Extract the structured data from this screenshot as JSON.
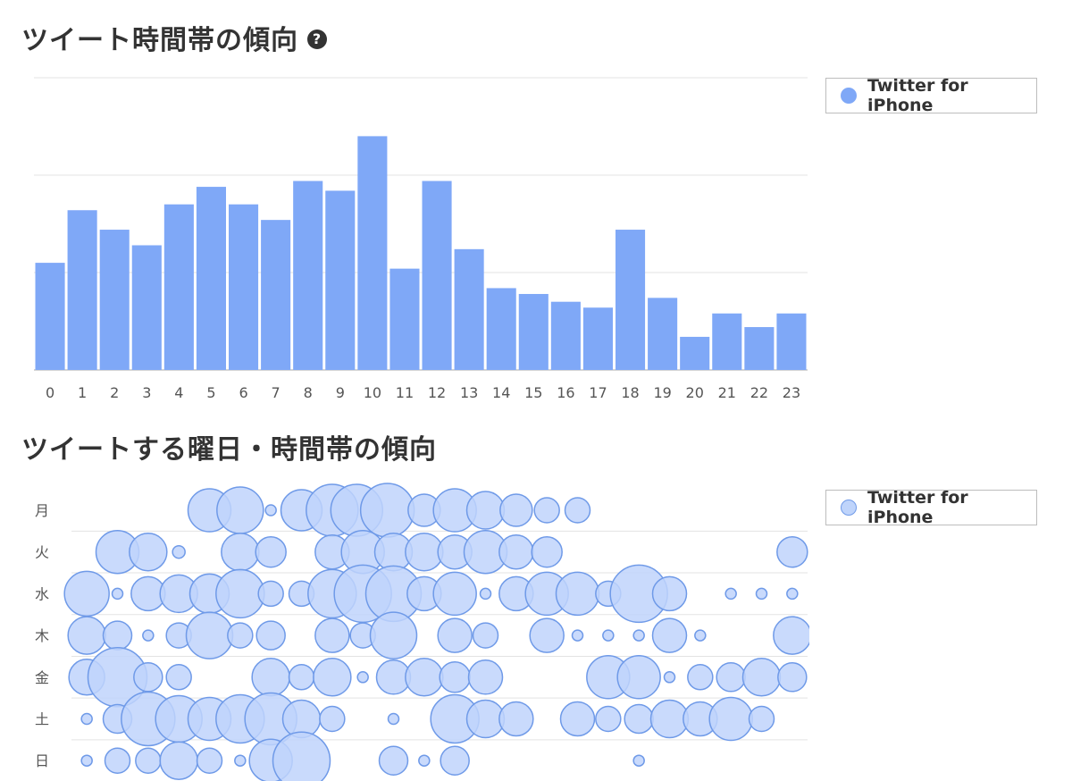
{
  "charts": {
    "hourly": {
      "title": "ツイート時間帯の傾向",
      "help_icon": "question-circle-icon",
      "legend_label": "Twitter for iPhone"
    },
    "weekday_hour": {
      "title": "ツイートする曜日・時間帯の傾向",
      "legend_label": "Twitter for iPhone"
    }
  },
  "colors": {
    "bar": "#7fa8f7",
    "bubble_fill": "#bfd4fb",
    "bubble_stroke": "#6f9ae8",
    "grid": "#e3e3e3",
    "axis": "#d4d4d4"
  },
  "chart_data": [
    {
      "type": "bar",
      "title": "ツイート時間帯の傾向",
      "categories": [
        "0",
        "1",
        "2",
        "3",
        "4",
        "5",
        "6",
        "7",
        "8",
        "9",
        "10",
        "11",
        "12",
        "13",
        "14",
        "15",
        "16",
        "17",
        "18",
        "19",
        "20",
        "21",
        "22",
        "23"
      ],
      "series": [
        {
          "name": "Twitter for iPhone",
          "values": [
            55,
            82,
            72,
            64,
            85,
            94,
            85,
            77,
            97,
            92,
            120,
            52,
            97,
            62,
            42,
            39,
            35,
            32,
            72,
            37,
            17,
            29,
            22,
            29
          ]
        }
      ],
      "ylim": [
        0,
        150
      ],
      "y_gridlines": [
        0,
        50,
        100,
        150
      ],
      "grid": true,
      "legend_position": "top-right"
    },
    {
      "type": "scatter",
      "title": "ツイートする曜日・時間帯の傾向",
      "description": "bubble chart; x = hour of day, y = weekday, bubble radius = count",
      "y_categories": [
        "月",
        "火",
        "水",
        "木",
        "金",
        "土",
        "日"
      ],
      "series": [
        {
          "name": "Twitter for iPhone",
          "points": [
            {
              "day": "月",
              "x": 4.5,
              "r": 24
            },
            {
              "day": "月",
              "x": 5.5,
              "r": 26
            },
            {
              "day": "月",
              "x": 6.5,
              "r": 6
            },
            {
              "day": "月",
              "x": 7.5,
              "r": 23
            },
            {
              "day": "月",
              "x": 8.5,
              "r": 29
            },
            {
              "day": "月",
              "x": 9.3,
              "r": 29
            },
            {
              "day": "月",
              "x": 10.3,
              "r": 30
            },
            {
              "day": "月",
              "x": 11.5,
              "r": 18
            },
            {
              "day": "月",
              "x": 12.5,
              "r": 24
            },
            {
              "day": "月",
              "x": 13.5,
              "r": 21
            },
            {
              "day": "月",
              "x": 14.5,
              "r": 18
            },
            {
              "day": "月",
              "x": 15.5,
              "r": 14
            },
            {
              "day": "月",
              "x": 16.5,
              "r": 14
            },
            {
              "day": "火",
              "x": 1.5,
              "r": 24
            },
            {
              "day": "火",
              "x": 2.5,
              "r": 21
            },
            {
              "day": "火",
              "x": 3.5,
              "r": 7
            },
            {
              "day": "火",
              "x": 5.5,
              "r": 21
            },
            {
              "day": "火",
              "x": 6.5,
              "r": 17
            },
            {
              "day": "火",
              "x": 8.5,
              "r": 19
            },
            {
              "day": "火",
              "x": 9.5,
              "r": 24
            },
            {
              "day": "火",
              "x": 10.5,
              "r": 21
            },
            {
              "day": "火",
              "x": 11.5,
              "r": 21
            },
            {
              "day": "火",
              "x": 12.5,
              "r": 19
            },
            {
              "day": "火",
              "x": 13.5,
              "r": 24
            },
            {
              "day": "火",
              "x": 14.5,
              "r": 19
            },
            {
              "day": "火",
              "x": 15.5,
              "r": 17
            },
            {
              "day": "火",
              "x": 23.5,
              "r": 17
            },
            {
              "day": "水",
              "x": 0.5,
              "r": 25
            },
            {
              "day": "水",
              "x": 1.5,
              "r": 6
            },
            {
              "day": "水",
              "x": 2.5,
              "r": 19
            },
            {
              "day": "水",
              "x": 3.5,
              "r": 21
            },
            {
              "day": "水",
              "x": 4.5,
              "r": 22
            },
            {
              "day": "水",
              "x": 5.5,
              "r": 27
            },
            {
              "day": "水",
              "x": 6.5,
              "r": 14
            },
            {
              "day": "水",
              "x": 7.5,
              "r": 14
            },
            {
              "day": "水",
              "x": 8.5,
              "r": 27
            },
            {
              "day": "水",
              "x": 9.5,
              "r": 32
            },
            {
              "day": "水",
              "x": 10.5,
              "r": 31
            },
            {
              "day": "水",
              "x": 11.5,
              "r": 19
            },
            {
              "day": "水",
              "x": 12.5,
              "r": 24
            },
            {
              "day": "水",
              "x": 13.5,
              "r": 6
            },
            {
              "day": "水",
              "x": 14.5,
              "r": 19
            },
            {
              "day": "水",
              "x": 15.5,
              "r": 24
            },
            {
              "day": "水",
              "x": 16.5,
              "r": 24
            },
            {
              "day": "水",
              "x": 17.5,
              "r": 14
            },
            {
              "day": "水",
              "x": 18.5,
              "r": 32
            },
            {
              "day": "水",
              "x": 19.5,
              "r": 19
            },
            {
              "day": "水",
              "x": 21.5,
              "r": 6
            },
            {
              "day": "水",
              "x": 22.5,
              "r": 6
            },
            {
              "day": "水",
              "x": 23.5,
              "r": 6
            },
            {
              "day": "木",
              "x": 0.5,
              "r": 21
            },
            {
              "day": "木",
              "x": 1.5,
              "r": 16
            },
            {
              "day": "木",
              "x": 2.5,
              "r": 6
            },
            {
              "day": "木",
              "x": 3.5,
              "r": 14
            },
            {
              "day": "木",
              "x": 4.5,
              "r": 26
            },
            {
              "day": "木",
              "x": 5.5,
              "r": 14
            },
            {
              "day": "木",
              "x": 6.5,
              "r": 16
            },
            {
              "day": "木",
              "x": 8.5,
              "r": 19
            },
            {
              "day": "木",
              "x": 9.5,
              "r": 14
            },
            {
              "day": "木",
              "x": 10.5,
              "r": 26
            },
            {
              "day": "木",
              "x": 12.5,
              "r": 19
            },
            {
              "day": "木",
              "x": 13.5,
              "r": 14
            },
            {
              "day": "木",
              "x": 15.5,
              "r": 19
            },
            {
              "day": "木",
              "x": 16.5,
              "r": 6
            },
            {
              "day": "木",
              "x": 17.5,
              "r": 6
            },
            {
              "day": "木",
              "x": 18.5,
              "r": 6
            },
            {
              "day": "木",
              "x": 19.5,
              "r": 19
            },
            {
              "day": "木",
              "x": 20.5,
              "r": 6
            },
            {
              "day": "木",
              "x": 23.5,
              "r": 21
            },
            {
              "day": "金",
              "x": 0.5,
              "r": 20
            },
            {
              "day": "金",
              "x": 1.5,
              "r": 33
            },
            {
              "day": "金",
              "x": 2.5,
              "r": 16
            },
            {
              "day": "金",
              "x": 3.5,
              "r": 14
            },
            {
              "day": "金",
              "x": 6.5,
              "r": 21
            },
            {
              "day": "金",
              "x": 7.5,
              "r": 14
            },
            {
              "day": "金",
              "x": 8.5,
              "r": 21
            },
            {
              "day": "金",
              "x": 9.5,
              "r": 6
            },
            {
              "day": "金",
              "x": 10.5,
              "r": 19
            },
            {
              "day": "金",
              "x": 11.5,
              "r": 21
            },
            {
              "day": "金",
              "x": 12.5,
              "r": 17
            },
            {
              "day": "金",
              "x": 13.5,
              "r": 19
            },
            {
              "day": "金",
              "x": 17.5,
              "r": 24
            },
            {
              "day": "金",
              "x": 18.5,
              "r": 24
            },
            {
              "day": "金",
              "x": 19.5,
              "r": 6
            },
            {
              "day": "金",
              "x": 20.5,
              "r": 14
            },
            {
              "day": "金",
              "x": 21.5,
              "r": 16
            },
            {
              "day": "金",
              "x": 22.5,
              "r": 21
            },
            {
              "day": "金",
              "x": 23.5,
              "r": 16
            },
            {
              "day": "土",
              "x": 0.5,
              "r": 6
            },
            {
              "day": "土",
              "x": 1.5,
              "r": 16
            },
            {
              "day": "土",
              "x": 2.5,
              "r": 30
            },
            {
              "day": "土",
              "x": 3.5,
              "r": 26
            },
            {
              "day": "土",
              "x": 4.5,
              "r": 24
            },
            {
              "day": "土",
              "x": 5.5,
              "r": 27
            },
            {
              "day": "土",
              "x": 6.5,
              "r": 29
            },
            {
              "day": "土",
              "x": 7.5,
              "r": 21
            },
            {
              "day": "土",
              "x": 8.5,
              "r": 14
            },
            {
              "day": "土",
              "x": 10.5,
              "r": 6
            },
            {
              "day": "土",
              "x": 12.5,
              "r": 27
            },
            {
              "day": "土",
              "x": 13.5,
              "r": 21
            },
            {
              "day": "土",
              "x": 14.5,
              "r": 19
            },
            {
              "day": "土",
              "x": 16.5,
              "r": 19
            },
            {
              "day": "土",
              "x": 17.5,
              "r": 14
            },
            {
              "day": "土",
              "x": 18.5,
              "r": 16
            },
            {
              "day": "土",
              "x": 19.5,
              "r": 21
            },
            {
              "day": "土",
              "x": 20.5,
              "r": 19
            },
            {
              "day": "土",
              "x": 21.5,
              "r": 24
            },
            {
              "day": "土",
              "x": 22.5,
              "r": 14
            },
            {
              "day": "日",
              "x": 0.5,
              "r": 6
            },
            {
              "day": "日",
              "x": 1.5,
              "r": 14
            },
            {
              "day": "日",
              "x": 2.5,
              "r": 14
            },
            {
              "day": "日",
              "x": 3.5,
              "r": 21
            },
            {
              "day": "日",
              "x": 4.5,
              "r": 14
            },
            {
              "day": "日",
              "x": 5.5,
              "r": 6
            },
            {
              "day": "日",
              "x": 6.5,
              "r": 24
            },
            {
              "day": "日",
              "x": 7.5,
              "r": 32
            },
            {
              "day": "日",
              "x": 10.5,
              "r": 16
            },
            {
              "day": "日",
              "x": 11.5,
              "r": 6
            },
            {
              "day": "日",
              "x": 12.5,
              "r": 16
            },
            {
              "day": "日",
              "x": 18.5,
              "r": 6
            }
          ]
        }
      ],
      "legend_position": "top-right"
    }
  ]
}
